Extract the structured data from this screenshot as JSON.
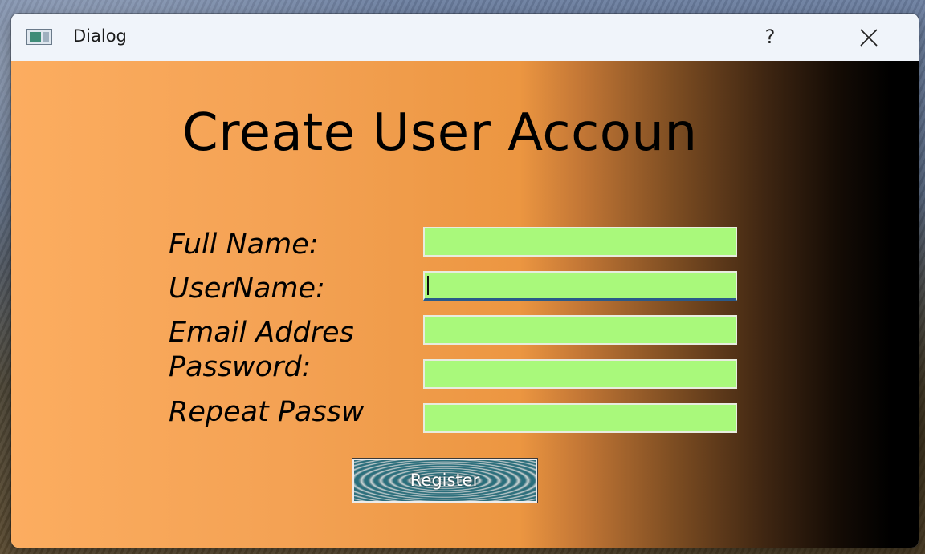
{
  "window": {
    "title": "Dialog",
    "help_label": "?",
    "app_icon": "window-icon",
    "close_icon": "close-icon"
  },
  "form": {
    "heading": "Create User Accoun",
    "fields": [
      {
        "label": "Full Name:",
        "value": ""
      },
      {
        "label": "UserName:",
        "value": ""
      },
      {
        "label": "Email Addres",
        "value": ""
      },
      {
        "label": "Password:",
        "value": ""
      },
      {
        "label": "Repeat Passw",
        "value": ""
      }
    ],
    "register_label": "Register"
  },
  "colors": {
    "input_background": "#a9f97b",
    "gradient_start": "#fcad60",
    "gradient_end": "#000000"
  }
}
